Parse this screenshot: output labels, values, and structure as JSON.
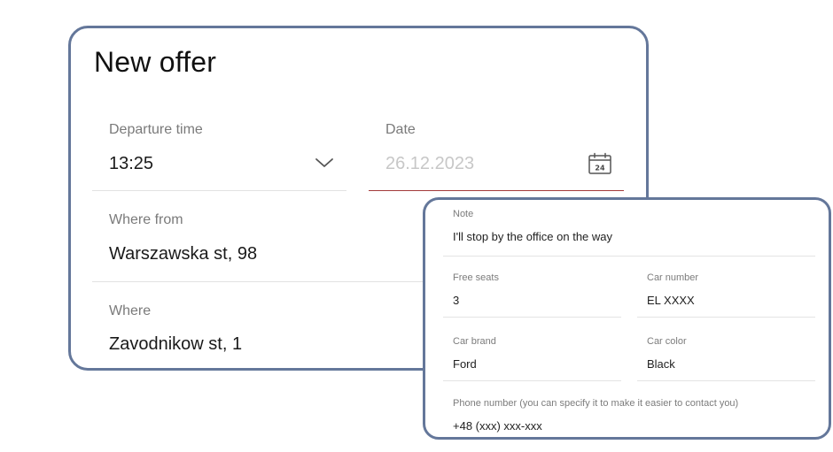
{
  "form": {
    "title": "New offer",
    "departure_time": {
      "label": "Departure time",
      "value": "13:25"
    },
    "date": {
      "label": "Date",
      "placeholder": "26.12.2023",
      "calendar_day": "24"
    },
    "where_from": {
      "label": "Where from",
      "value": "Warszawska st, 98"
    },
    "where_to": {
      "label": "Where",
      "value": "Zavodnikow st, 1"
    }
  },
  "details": {
    "note": {
      "label": "Note",
      "value": "I'll stop by the office on the way"
    },
    "free_seats": {
      "label": "Free seats",
      "value": "3"
    },
    "car_number": {
      "label": "Car number",
      "value": "EL XXXX"
    },
    "car_brand": {
      "label": "Car brand",
      "value": "Ford"
    },
    "car_color": {
      "label": "Car color",
      "value": "Black"
    },
    "phone": {
      "label": "Phone number (you can specify it to make it easier to contact you)",
      "value": "+48 (xxx) xxx-xxx"
    }
  },
  "colors": {
    "card_border": "#64779a",
    "date_underline": "#a33a3a",
    "label": "#7a7a7a",
    "text": "#1a1a1a"
  },
  "icons": {
    "dropdown": "chevron-down-icon",
    "date_picker": "calendar-icon"
  }
}
